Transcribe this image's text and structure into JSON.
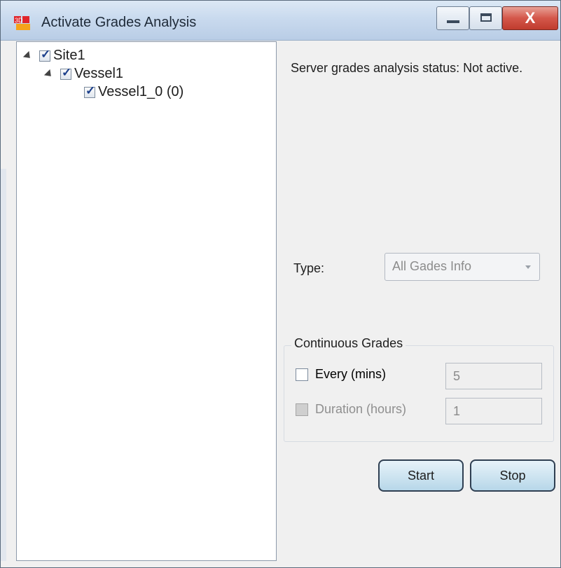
{
  "window": {
    "title": "Activate Grades Analysis",
    "controls": {
      "minimize": "minimize",
      "maximize": "maximize",
      "close": "X"
    }
  },
  "tree": {
    "nodes": [
      {
        "label": "Site1",
        "checked": true,
        "expanded": true,
        "level": 0
      },
      {
        "label": "Vessel1",
        "checked": true,
        "expanded": true,
        "level": 1
      },
      {
        "label": "Vessel1_0 (0)",
        "checked": true,
        "expanded": false,
        "level": 2
      }
    ]
  },
  "status": {
    "text": "Server grades analysis status: Not active."
  },
  "type": {
    "label": "Type:",
    "selected": "All Gades Info"
  },
  "continuous": {
    "title": "Continuous Grades",
    "every": {
      "label": "Every (mins)",
      "checked": false,
      "value": "5"
    },
    "duration": {
      "label": "Duration (hours)",
      "checked": false,
      "value": "1"
    }
  },
  "actions": {
    "start": "Start",
    "stop": "Stop"
  },
  "colors": {
    "close_button": "#d4574a",
    "button_border": "#2f3f52",
    "button_fill": "#cfe5f1"
  }
}
